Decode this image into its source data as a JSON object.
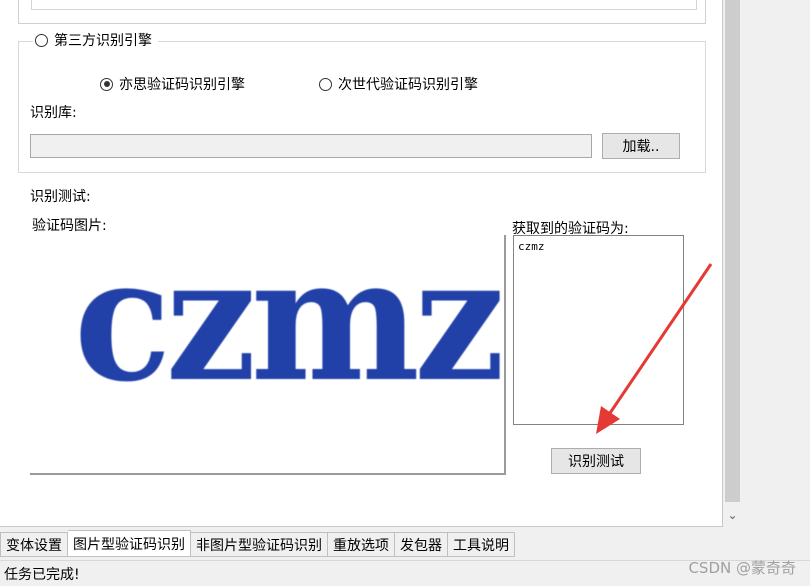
{
  "engine_group": {
    "legend": "第三方识别引擎",
    "option_yisi": "亦思验证码识别引擎",
    "option_cishidai": "次世代验证码识别引擎",
    "library_label": "识别库:",
    "library_value": "",
    "load_button": "加载..",
    "selected": "option_yisi"
  },
  "test": {
    "section_label": "识别测试:",
    "image_label": "验证码图片:",
    "captcha_image_text": "czmz",
    "result_label": "获取到的验证码为:",
    "result_value": "czmz",
    "test_button": "识别测试"
  },
  "tabs": [
    {
      "label": "变体设置",
      "active": false
    },
    {
      "label": "图片型验证码识别",
      "active": true
    },
    {
      "label": "非图片型验证码识别",
      "active": false
    },
    {
      "label": "重放选项",
      "active": false
    },
    {
      "label": "发包器",
      "active": false
    },
    {
      "label": "工具说明",
      "active": false
    }
  ],
  "status": {
    "text": "任务已完成!"
  },
  "watermark": "CSDN @蒙奇奇",
  "colors": {
    "captcha_text": "#2141a8",
    "annotation_arrow": "#e53935"
  },
  "icons": {
    "scroll_down": "chevron-down-icon"
  }
}
